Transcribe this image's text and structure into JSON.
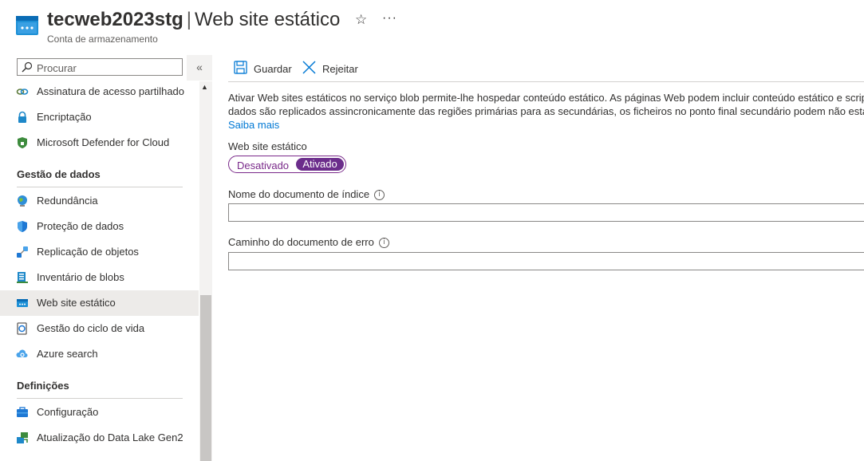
{
  "header": {
    "resource_name": "tecweb2023stg",
    "separator": "|",
    "page_name": "Web site estático",
    "subtitle": "Conta de armazenamento",
    "favorite_icon": "star-icon",
    "more_icon": "more-icon",
    "more_glyph": "···"
  },
  "sidebar": {
    "search_placeholder": "Procurar",
    "collapse_glyph": "«",
    "items_top": [
      {
        "label": "Assinatura de acesso partilhado",
        "icon": "link-icon"
      },
      {
        "label": "Encriptação",
        "icon": "lock-icon"
      },
      {
        "label": "Microsoft Defender for Cloud",
        "icon": "shield-icon"
      }
    ],
    "section_data": "Gestão de dados",
    "items_data": [
      {
        "label": "Redundância",
        "icon": "globe-icon"
      },
      {
        "label": "Proteção de dados",
        "icon": "shield-blue-icon"
      },
      {
        "label": "Replicação de objetos",
        "icon": "replication-icon"
      },
      {
        "label": "Inventário de blobs",
        "icon": "inventory-icon"
      },
      {
        "label": "Web site estático",
        "icon": "static-website-icon",
        "active": true
      },
      {
        "label": "Gestão do ciclo de vida",
        "icon": "lifecycle-icon"
      },
      {
        "label": "Azure search",
        "icon": "cloud-search-icon"
      }
    ],
    "section_settings": "Definições",
    "items_settings": [
      {
        "label": "Configuração",
        "icon": "configuration-icon"
      },
      {
        "label": "Atualização do Data Lake Gen2",
        "icon": "data-lake-icon"
      }
    ]
  },
  "toolbar": {
    "save_label": "Guardar",
    "discard_label": "Rejeitar"
  },
  "main": {
    "description_line1": "Ativar Web sites estáticos no serviço blob permite-lhe hospedar conteúdo estático. As páginas Web podem incluir conteúdo estático e scrip",
    "description_line2": "dados são replicados assincronicamente das regiões primárias para as secundárias, os ficheiros no ponto final secundário podem não estar",
    "learn_more": "Saiba mais",
    "static_website_label": "Web site estático",
    "toggle_off": "Desativado",
    "toggle_on": "Ativado",
    "toggle_state": "Ativado",
    "index_doc_label": "Nome do documento de índice",
    "index_doc_value": "",
    "error_doc_label": "Caminho do documento de erro",
    "error_doc_value": "",
    "info_glyph": "i"
  },
  "colors": {
    "accent": "#0078d4",
    "toggle_on": "#6b2d8b",
    "active_nav_bg": "#edebe9"
  }
}
